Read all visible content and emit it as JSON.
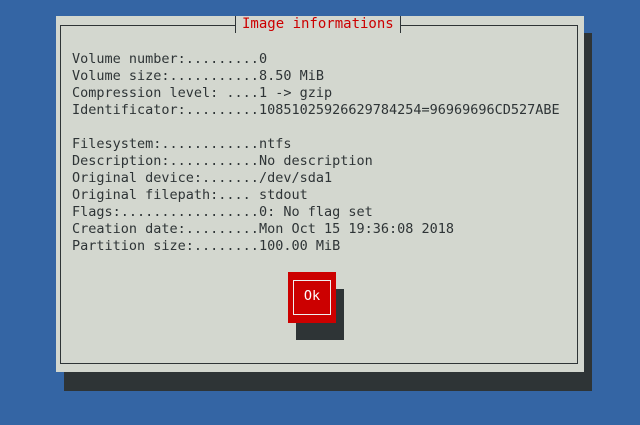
{
  "dialog": {
    "title": "Image informations",
    "info": [
      {
        "label": "Volume number:.........",
        "value": "0"
      },
      {
        "label": "Volume size:...........",
        "value": "8.50 MiB"
      },
      {
        "label": "Compression level: ....",
        "value": "1 -> gzip"
      },
      {
        "label": "Identificator:.........",
        "value": "10851025926629784254=96969696CD527ABE"
      },
      {
        "label": "",
        "value": ""
      },
      {
        "label": "Filesystem:............",
        "value": "ntfs"
      },
      {
        "label": "Description:...........",
        "value": "No description"
      },
      {
        "label": "Original device:.......",
        "value": "/dev/sda1"
      },
      {
        "label": "Original filepath:.... ",
        "value": "stdout"
      },
      {
        "label": "Flags:.................",
        "value": "0: No flag set"
      },
      {
        "label": "Creation date:.........",
        "value": "Mon Oct 15 19:36:08 2018"
      },
      {
        "label": "Partition size:........",
        "value": "100.00 MiB"
      }
    ],
    "ok_label": "Ok"
  },
  "colors": {
    "background": "#3465a4",
    "dialog": "#d3d7cf",
    "shadow": "#2e3436",
    "title": "#cc0000",
    "button": "#cc0000"
  }
}
